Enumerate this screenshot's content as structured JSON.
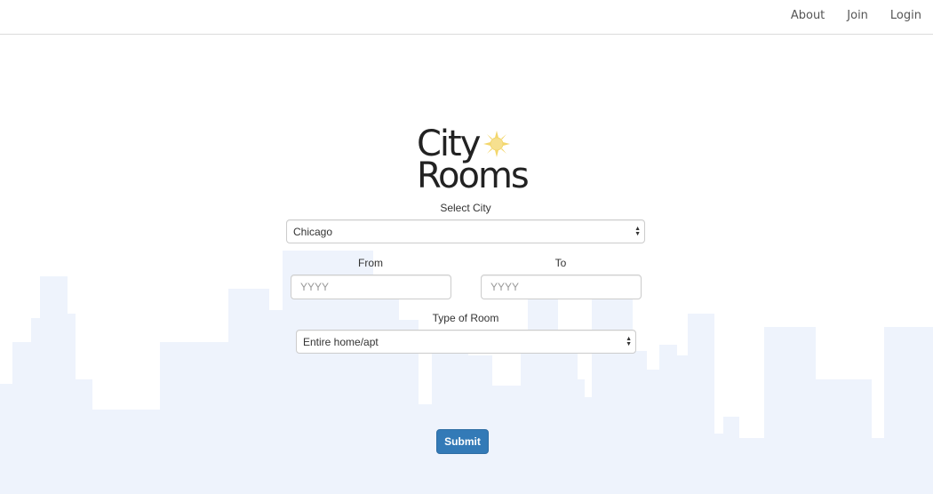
{
  "nav": {
    "links": [
      "About",
      "Join",
      "Login"
    ]
  },
  "logo": {
    "line1": "City",
    "line2": "Rooms",
    "icon": "sun-icon",
    "icon_color": "#f5d76e"
  },
  "form": {
    "city_label": "Select City",
    "city_value": "Chicago",
    "from_label": "From",
    "from_placeholder": "YYYY",
    "to_label": "To",
    "to_placeholder": "YYYY",
    "room_label": "Type of Room",
    "room_value": "Entire home/apt",
    "submit_label": "Submit"
  },
  "colors": {
    "skyline": "#eef3fc",
    "submit": "#337ab7"
  }
}
